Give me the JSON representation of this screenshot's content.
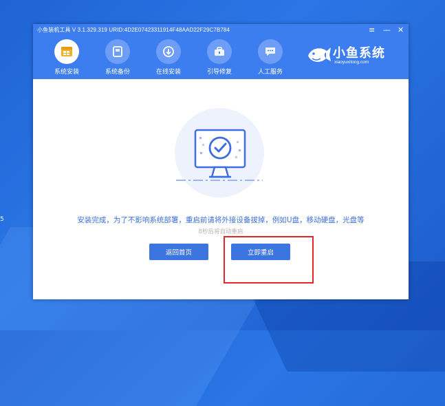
{
  "desktop": {
    "side_text": "5"
  },
  "window": {
    "title": "小鱼装机工具 V 3.1.329.319 URID:4D2E07423311914F48AAD22F29C7B784",
    "controls": {
      "menu": "≡",
      "minimize": "—",
      "close": "✕"
    }
  },
  "nav": [
    {
      "label": "系统安装",
      "icon": "windows-icon",
      "active": true
    },
    {
      "label": "系统备份",
      "icon": "backup-icon",
      "active": false
    },
    {
      "label": "在线安装",
      "icon": "download-icon",
      "active": false
    },
    {
      "label": "引导修复",
      "icon": "toolbox-icon",
      "active": false
    },
    {
      "label": "人工服务",
      "icon": "chat-icon",
      "active": false
    }
  ],
  "logo": {
    "main": "小鱼系统",
    "sub": "xiaoyuxitong.com"
  },
  "main": {
    "message": "安装完成，为了不影响系统部署，重启前请将外接设备拔掉，例如U盘，移动硬盘，光盘等",
    "countdown": "8秒后将自动重启",
    "back_button": "返回首页",
    "restart_button": "立即重启"
  },
  "colors": {
    "accent": "#3c7df0",
    "button": "#3c74e0",
    "highlight": "#e5252a",
    "message": "#3b6fd8"
  }
}
